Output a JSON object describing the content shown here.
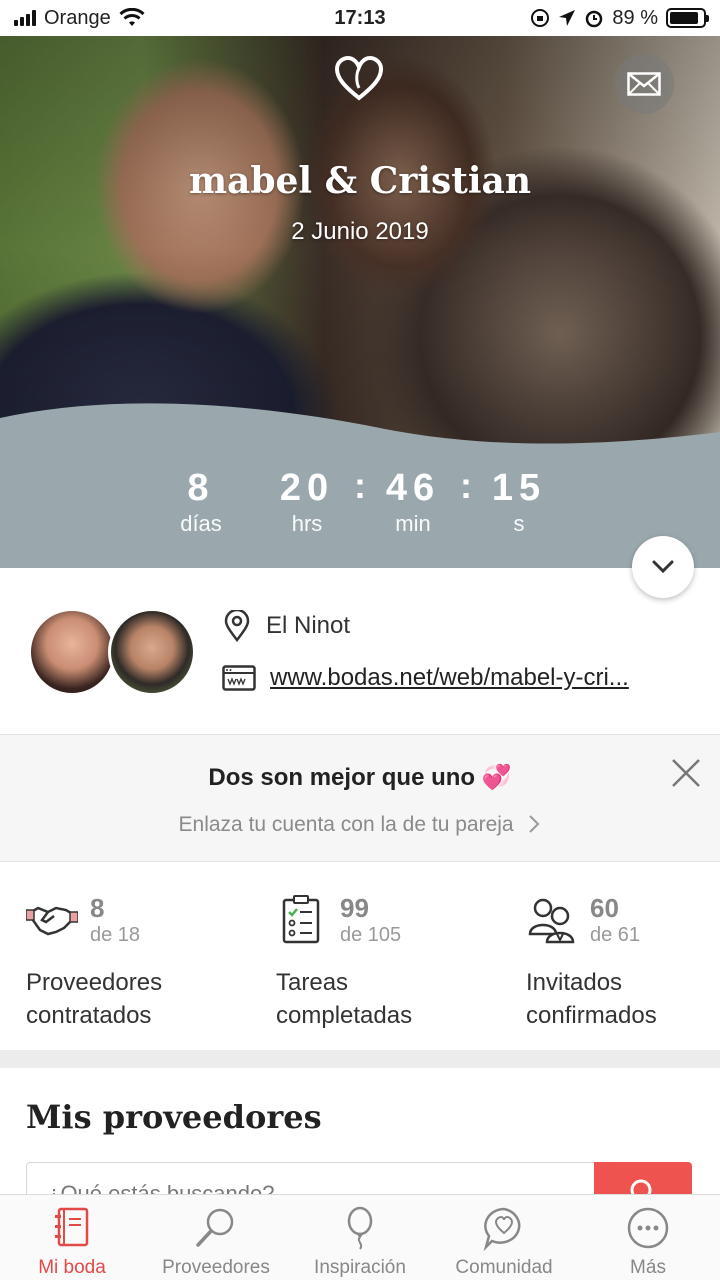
{
  "status_bar": {
    "carrier": "Orange",
    "time": "17:13",
    "battery_percent": "89 %",
    "battery_level": 0.89
  },
  "hero": {
    "couple_names": "mabel & Cristian",
    "wedding_date": "2 Junio 2019",
    "countdown": [
      {
        "value": "8",
        "label": "días"
      },
      {
        "value": "20",
        "label": "hrs"
      },
      {
        "value": "46",
        "label": "min"
      },
      {
        "value": "15",
        "label": "s"
      }
    ]
  },
  "profile": {
    "venue": "El Ninot",
    "website": "www.bodas.net/web/mabel-y-cri..."
  },
  "promo": {
    "title": "Dos son mejor que uno",
    "title_emoji": "💞",
    "link_text": "Enlaza tu cuenta con la de tu pareja"
  },
  "stats": [
    {
      "icon": "handshake-icon",
      "value": "8",
      "total": "de 18",
      "label_line1": "Proveedores",
      "label_line2": "contratados"
    },
    {
      "icon": "checklist-icon",
      "value": "99",
      "total": "de 105",
      "label_line1": "Tareas",
      "label_line2": "completadas"
    },
    {
      "icon": "guests-icon",
      "value": "60",
      "total": "de 61",
      "label_line1": "Invitados",
      "label_line2": "confirmados"
    }
  ],
  "providers": {
    "title": "Mis proveedores",
    "search_placeholder": "¿Qué estás buscando?"
  },
  "tabbar": {
    "items": [
      {
        "label": "Mi boda",
        "icon": "notebook-icon",
        "active": true
      },
      {
        "label": "Proveedores",
        "icon": "search-icon",
        "active": false
      },
      {
        "label": "Inspiración",
        "icon": "balloon-icon",
        "active": false
      },
      {
        "label": "Comunidad",
        "icon": "chat-heart-icon",
        "active": false
      },
      {
        "label": "Más",
        "icon": "more-icon",
        "active": false
      }
    ]
  },
  "colors": {
    "accent": "#e34a47",
    "wave": "#9aa8ae",
    "search_button": "#ef5350"
  }
}
